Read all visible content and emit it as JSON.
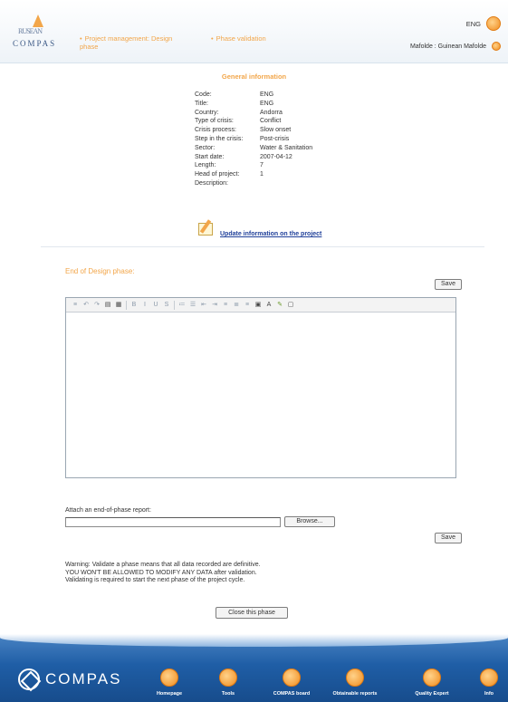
{
  "header": {
    "logo_top": "RUSEAN",
    "logo_word": "COMPAS",
    "breadcrumb": [
      "Project management: Design phase",
      "Phase validation"
    ],
    "language": "ENG",
    "user": "Mafolde : Guinean Mafolde"
  },
  "general_info": {
    "title": "General information",
    "rows": [
      {
        "key": "Code:",
        "value": "ENG"
      },
      {
        "key": "Title:",
        "value": "ENG"
      },
      {
        "key": "Country:",
        "value": "Andorra"
      },
      {
        "key": "Type of crisis:",
        "value": "Conflict"
      },
      {
        "key": "Crisis process:",
        "value": "Slow onset"
      },
      {
        "key": "Step in the crisis:",
        "value": "Post-crisis"
      },
      {
        "key": "Sector:",
        "value": "Water & Sanitation"
      },
      {
        "key": "Start date:",
        "value": "2007-04-12"
      },
      {
        "key": "Length:",
        "value": "7"
      },
      {
        "key": "Head of project:",
        "value": "1"
      },
      {
        "key": "Description:",
        "value": ""
      }
    ],
    "update_link": "Update information on the project"
  },
  "end_of_phase": {
    "title": "End of Design phase:",
    "save_label": "Save",
    "attach_label": "Attach an end-of-phase report:",
    "browse_label": "Browse...",
    "warning": [
      "Warning: Validate a phase means that all data recorded are definitive.",
      "YOU WON'T BE ALLOWED TO MODIFY ANY DATA after validation.",
      "Validating is required to start the next phase of the project cycle."
    ],
    "close_label": "Close this phase"
  },
  "footer": {
    "logo_word": "COMPAS",
    "nav": [
      "Homepage",
      "Tools",
      "COMPAS board",
      "Obtainable reports",
      "Quality Expert",
      "Info"
    ]
  },
  "colors": {
    "accent": "#f2a64a",
    "footer_blue": "#1f5ea6",
    "link": "#20409a"
  }
}
